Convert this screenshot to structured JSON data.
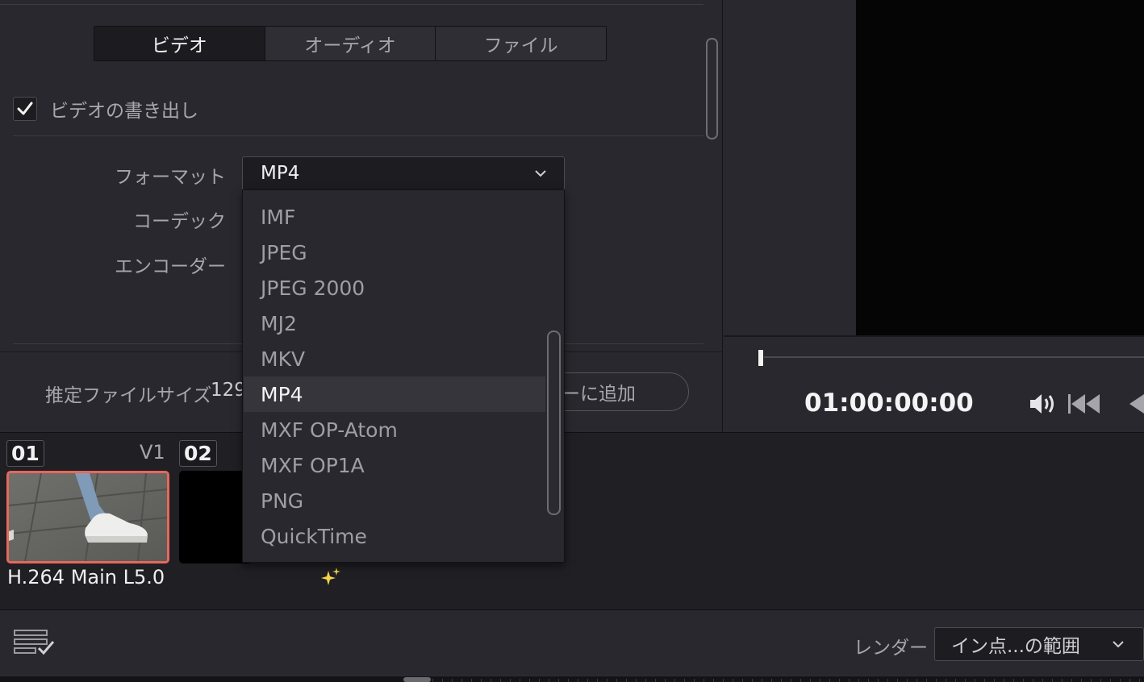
{
  "tabs": [
    {
      "label": "ビデオ",
      "active": true
    },
    {
      "label": "オーディオ",
      "active": false
    },
    {
      "label": "ファイル",
      "active": false
    }
  ],
  "video_export": {
    "label": "ビデオの書き出し",
    "checked": true
  },
  "fields": {
    "format_label": "フォーマット",
    "format_value": "MP4",
    "codec_label": "コーデック",
    "encoder_label": "エンコーダー"
  },
  "format_options": [
    "IMF",
    "JPEG",
    "JPEG 2000",
    "MJ2",
    "MKV",
    "MP4",
    "MXF OP-Atom",
    "MXF OP1A",
    "PNG",
    "QuickTime"
  ],
  "format_selected": "MP4",
  "estimated_size": {
    "label": "推定ファイルサイズ",
    "value": "129"
  },
  "add_to_queue_label": "ューに追加",
  "viewer": {
    "timecode": "01:00:00:00"
  },
  "clips": [
    {
      "number": "01",
      "track": "V1",
      "caption": "H.264 Main L5.0"
    },
    {
      "number": "02"
    }
  ],
  "render": {
    "label": "レンダー",
    "value": "イン点...の範囲"
  },
  "colors": {
    "accent_clip_border": "#e8675b",
    "sparkle": "#f5d547"
  },
  "icons": [
    "checkmark-icon",
    "chevron-down-icon",
    "volume-icon",
    "go-to-start-icon",
    "previous-frame-icon",
    "sparkle-icon",
    "render-queue-icon"
  ]
}
